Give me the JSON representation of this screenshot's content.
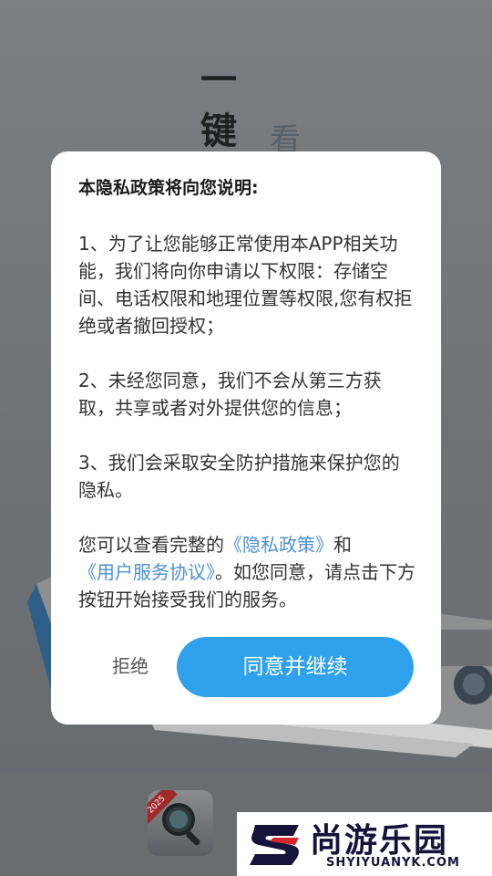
{
  "splash": {
    "slogan_main": "一键",
    "slogan_sub": "看"
  },
  "dialog": {
    "title": "本隐私政策将向您说明:",
    "para1": "1、为了让您能够正常使用本APP相关功能，我们将向你申请以下权限：存储空间、电话权限和地理位置等权限,您有权拒绝或者撤回授权；",
    "para2": "2、未经您同意，我们不会从第三方获取，共享或者对外提供您的信息；",
    "para3": "3、我们会采取安全防护措施来保护您的隐私。",
    "para4_prefix": "您可以查看完整的",
    "privacy_link": "《隐私政策》",
    "para4_and": "和",
    "service_link": "《用户服务协议》",
    "para4_suffix": "。如您同意，请点击下方按钮开始接受我们的服务。",
    "reject_label": "拒绝",
    "agree_label": "同意并继续"
  },
  "app_icon": {
    "badge": "2025",
    "icon": "magnifier-icon"
  },
  "watermark": {
    "title": "尚游乐园",
    "url": "SHYIYUANYK.COM"
  },
  "colors": {
    "accent": "#2fa0ec",
    "link": "#4a90d9",
    "overlay": "#6f7276"
  }
}
